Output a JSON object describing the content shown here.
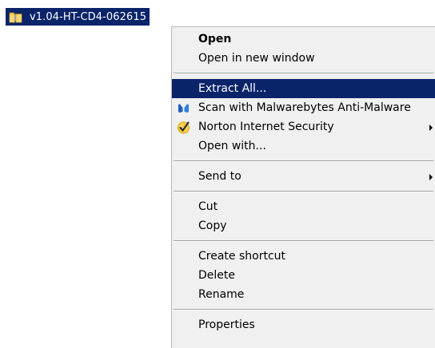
{
  "file": {
    "name": "v1.04-HT-CD4-062615",
    "icon": "zip-folder-icon"
  },
  "menu": {
    "open": "Open",
    "open_new_window": "Open in new window",
    "extract_all": "Extract All...",
    "scan_malwarebytes": "Scan with Malwarebytes Anti-Malware",
    "norton": "Norton Internet Security",
    "open_with": "Open with...",
    "send_to": "Send to",
    "cut": "Cut",
    "copy": "Copy",
    "create_shortcut": "Create shortcut",
    "delete": "Delete",
    "rename": "Rename",
    "properties": "Properties",
    "highlighted_item": "Extract All...",
    "icons": {
      "malwarebytes": "malwarebytes-icon",
      "norton": "norton-checkmark-icon",
      "submenu": "chevron-right-icon"
    }
  },
  "colors": {
    "selection": "#0a246a",
    "menu_background": "#f0f0f0",
    "norton_check": "#f7b500"
  }
}
